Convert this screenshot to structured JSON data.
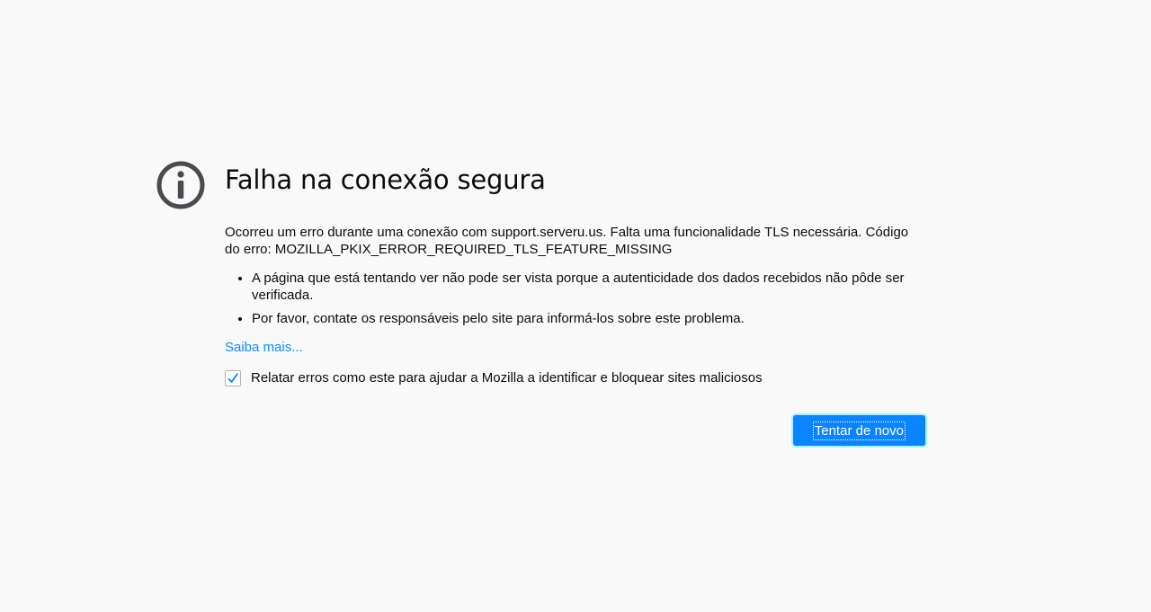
{
  "error_page": {
    "title": "Falha na conexão segura",
    "description": "Ocorreu um erro durante uma conexão com support.serveru.us. Falta uma funcionalidade TLS necessária. Código do erro: MOZILLA_PKIX_ERROR_REQUIRED_TLS_FEATURE_MISSING",
    "reasons": [
      "A página que está tentando ver não pode ser vista porque a autenticidade dos dados recebidos não pôde ser verificada.",
      "Por favor, contate os responsáveis pelo site para informá-los sobre este problema."
    ],
    "learn_more": "Saiba mais...",
    "report_label": "Relatar erros como este para ajudar a Mozilla a identificar e bloquear sites maliciosos",
    "report_checked": true,
    "retry_button": "Tentar de novo"
  },
  "icons": {
    "info": "info-icon",
    "check": "check-icon"
  },
  "colors": {
    "background": "#f9f9fa",
    "accent": "#0a84ff",
    "link": "#0a8dff",
    "icon": "#4a4a4f"
  }
}
